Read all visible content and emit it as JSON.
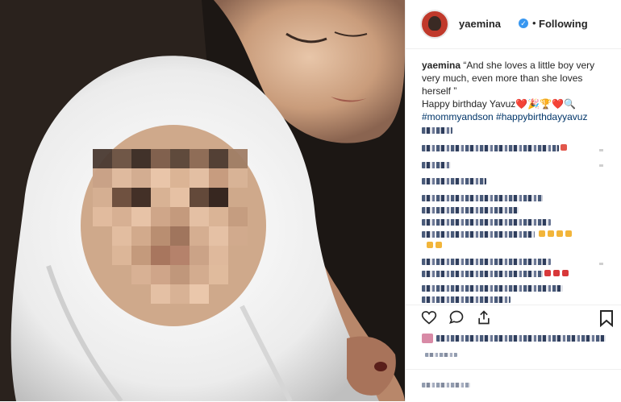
{
  "post": {
    "author": {
      "username": "yaemina",
      "verified_icon": "✓",
      "separator": "•",
      "follow_status": "Following"
    },
    "caption": {
      "username": "yaemina",
      "text": "“And she loves a little boy very very much, even more than she loves herself ”",
      "line2_text": "Happy birthday Yavuz",
      "line2_emojis": "❤️🎉🏆❤️🔍",
      "hashtags": "#mommyandson #happybirthdayyavuz"
    },
    "actions": {
      "like_icon": "heart-icon",
      "comment_icon": "comment-icon",
      "share_icon": "share-icon",
      "save_icon": "bookmark-icon"
    },
    "colors": {
      "link": "#003569",
      "text": "#262626",
      "verified": "#3897f0",
      "border": "#efefef"
    }
  }
}
